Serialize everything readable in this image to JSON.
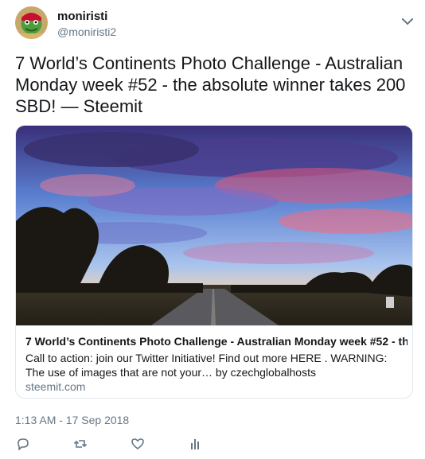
{
  "author": {
    "display_name": "moniristi",
    "handle": "@moniristi2",
    "avatar_icon": "avatar-image"
  },
  "tweet": {
    "text": "7 World’s Continents Photo Challenge - Australian Monday week #52 - the absolute winner takes 200 SBD! — Steemit",
    "timestamp": "1:13 AM - 17 Sep 2018"
  },
  "card": {
    "title": "7 World’s Continents Photo Challenge - Australian Monday week #52 - th...",
    "description": "Call to action: join our Twitter Initiative! Find out more HERE . WARNING: The use of images that are not your… by czechglobalhosts",
    "domain": "steemit.com",
    "image_icon": "outback-road-sunset-photo"
  },
  "actions": {
    "reply_icon": "reply-icon",
    "retweet_icon": "retweet-icon",
    "like_icon": "heart-icon",
    "analytics_icon": "analytics-icon"
  },
  "colors": {
    "text": "#14171a",
    "muted": "#657786",
    "border": "#e1e8ed"
  }
}
